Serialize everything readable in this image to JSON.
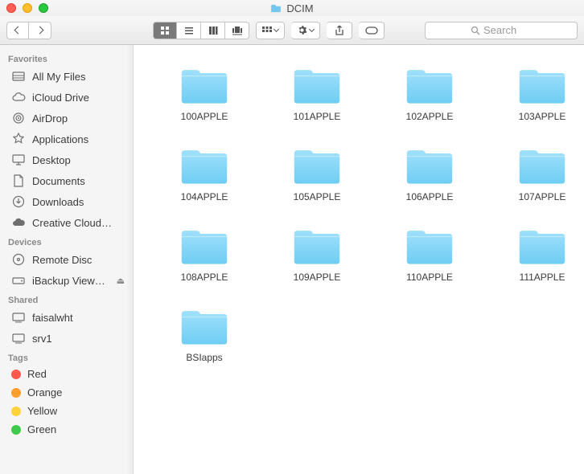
{
  "window": {
    "title": "DCIM"
  },
  "toolbar": {
    "search_placeholder": "Search"
  },
  "sidebar": {
    "sections": [
      {
        "heading": "Favorites",
        "items": [
          {
            "label": "All My Files",
            "icon": "all-my-files"
          },
          {
            "label": "iCloud Drive",
            "icon": "cloud"
          },
          {
            "label": "AirDrop",
            "icon": "airdrop"
          },
          {
            "label": "Applications",
            "icon": "applications"
          },
          {
            "label": "Desktop",
            "icon": "desktop"
          },
          {
            "label": "Documents",
            "icon": "documents"
          },
          {
            "label": "Downloads",
            "icon": "downloads"
          },
          {
            "label": "Creative Cloud…",
            "icon": "creative-cloud"
          }
        ]
      },
      {
        "heading": "Devices",
        "items": [
          {
            "label": "Remote Disc",
            "icon": "disc"
          },
          {
            "label": "iBackup View…",
            "icon": "drive",
            "eject": true
          }
        ]
      },
      {
        "heading": "Shared",
        "items": [
          {
            "label": "faisalwht",
            "icon": "computer"
          },
          {
            "label": "srv1",
            "icon": "computer"
          }
        ]
      },
      {
        "heading": "Tags",
        "items": [
          {
            "label": "Red",
            "icon": "tag",
            "color": "#ff5a4e"
          },
          {
            "label": "Orange",
            "icon": "tag",
            "color": "#ff9e2c"
          },
          {
            "label": "Yellow",
            "icon": "tag",
            "color": "#ffd23b"
          },
          {
            "label": "Green",
            "icon": "tag",
            "color": "#3ecb4c"
          }
        ]
      }
    ]
  },
  "folders": [
    {
      "name": "100APPLE"
    },
    {
      "name": "101APPLE"
    },
    {
      "name": "102APPLE"
    },
    {
      "name": "103APPLE"
    },
    {
      "name": "104APPLE"
    },
    {
      "name": "105APPLE"
    },
    {
      "name": "106APPLE"
    },
    {
      "name": "107APPLE"
    },
    {
      "name": "108APPLE"
    },
    {
      "name": "109APPLE"
    },
    {
      "name": "110APPLE"
    },
    {
      "name": "111APPLE"
    },
    {
      "name": "BSIapps"
    }
  ]
}
